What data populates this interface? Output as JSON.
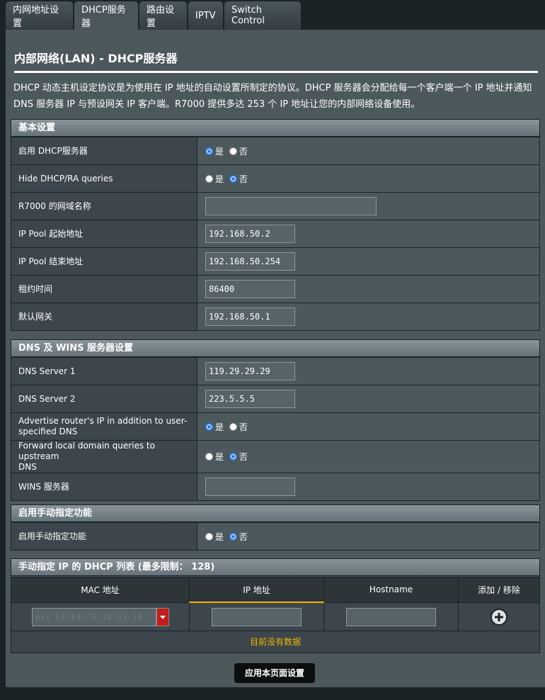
{
  "tabs": [
    {
      "label": "内网地址设置"
    },
    {
      "label": "DHCP服务器"
    },
    {
      "label": "路由设置"
    },
    {
      "label": "IPTV"
    },
    {
      "label": "Switch Control"
    }
  ],
  "page": {
    "title": "内部网络(LAN) - DHCP服务器",
    "desc_line1": "DHCP 动态主机设定协议是为使用在 IP 地址的自动设置所制定的协议。DHCP 服务器会分配给每一个客户端一个 IP 地址并通知",
    "desc_line2": "DNS 服务器 IP 与预设网关 IP 客户端。R7000 提供多达 253 个 IP 地址让您的内部网络设备使用。"
  },
  "basic": {
    "header": "基本设置",
    "enable_dhcp": {
      "label": "启用 DHCP服务器",
      "selected": "是"
    },
    "hide_dhcp": {
      "label": "Hide DHCP/RA queries",
      "selected": "否"
    },
    "domain_name": {
      "label": "R7000 的网域名称",
      "value": ""
    },
    "pool_start": {
      "label": "IP Pool 起始地址",
      "value": "192.168.50.2"
    },
    "pool_end": {
      "label": "IP Pool 结束地址",
      "value": "192.168.50.254"
    },
    "lease": {
      "label": "租约时间",
      "value": "86400"
    },
    "gateway": {
      "label": "默认网关",
      "value": "192.168.50.1"
    }
  },
  "dns": {
    "header": "DNS 及 WINS 服务器设置",
    "dns1": {
      "label": "DNS Server 1",
      "value": "119.29.29.29"
    },
    "dns2": {
      "label": "DNS Server 2",
      "value": "223.5.5.5"
    },
    "advertise": {
      "label_line1": "Advertise router's IP in addition to user-",
      "label_line2": "specified DNS",
      "selected": "是"
    },
    "forward": {
      "label_line1": "Forward local domain queries to upstream",
      "label_line2": "DNS",
      "selected": "否"
    },
    "wins": {
      "label": "WINS 服务器",
      "value": ""
    }
  },
  "manual": {
    "header": "启用手动指定功能",
    "enable": {
      "label": "启用手动指定功能",
      "selected": "否"
    }
  },
  "radio": {
    "yes": "是",
    "no": "否"
  },
  "list": {
    "header": "手动指定 IP 的 DHCP 列表 (最多限制： 128)",
    "col_mac": "MAC 地址",
    "col_ip": "IP 地址",
    "col_host": "Hostname",
    "col_action": "添加 / 移除",
    "mac_placeholder": "ex: E4:F4:C6:18:81:19",
    "no_data": "目前没有数据"
  },
  "apply_label": "应用本页面设置",
  "colors": {
    "accent": "#f0b400",
    "radio": "#2a7be0",
    "dropdown": "#c61c1c"
  }
}
